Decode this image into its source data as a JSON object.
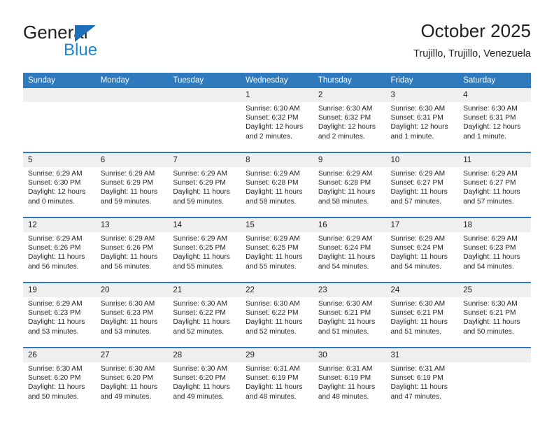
{
  "brand": {
    "name_part1": "General",
    "name_part2": "Blue",
    "triangle_color": "#1d6fb8",
    "blue_text_color": "#1b87d4"
  },
  "header": {
    "title": "October 2025",
    "subtitle": "Trujillo, Trujillo, Venezuela"
  },
  "theme": {
    "header_blue": "#2f79bd",
    "daynum_band": "#efefef",
    "text": "#231f20"
  },
  "weekdays": [
    "Sunday",
    "Monday",
    "Tuesday",
    "Wednesday",
    "Thursday",
    "Friday",
    "Saturday"
  ],
  "weeks": [
    {
      "days": [
        {
          "num": "",
          "sunrise": "",
          "sunset": "",
          "daylight": ""
        },
        {
          "num": "",
          "sunrise": "",
          "sunset": "",
          "daylight": ""
        },
        {
          "num": "",
          "sunrise": "",
          "sunset": "",
          "daylight": ""
        },
        {
          "num": "1",
          "sunrise": "Sunrise: 6:30 AM",
          "sunset": "Sunset: 6:32 PM",
          "daylight": "Daylight: 12 hours and 2 minutes."
        },
        {
          "num": "2",
          "sunrise": "Sunrise: 6:30 AM",
          "sunset": "Sunset: 6:32 PM",
          "daylight": "Daylight: 12 hours and 2 minutes."
        },
        {
          "num": "3",
          "sunrise": "Sunrise: 6:30 AM",
          "sunset": "Sunset: 6:31 PM",
          "daylight": "Daylight: 12 hours and 1 minute."
        },
        {
          "num": "4",
          "sunrise": "Sunrise: 6:30 AM",
          "sunset": "Sunset: 6:31 PM",
          "daylight": "Daylight: 12 hours and 1 minute."
        }
      ]
    },
    {
      "days": [
        {
          "num": "5",
          "sunrise": "Sunrise: 6:29 AM",
          "sunset": "Sunset: 6:30 PM",
          "daylight": "Daylight: 12 hours and 0 minutes."
        },
        {
          "num": "6",
          "sunrise": "Sunrise: 6:29 AM",
          "sunset": "Sunset: 6:29 PM",
          "daylight": "Daylight: 11 hours and 59 minutes."
        },
        {
          "num": "7",
          "sunrise": "Sunrise: 6:29 AM",
          "sunset": "Sunset: 6:29 PM",
          "daylight": "Daylight: 11 hours and 59 minutes."
        },
        {
          "num": "8",
          "sunrise": "Sunrise: 6:29 AM",
          "sunset": "Sunset: 6:28 PM",
          "daylight": "Daylight: 11 hours and 58 minutes."
        },
        {
          "num": "9",
          "sunrise": "Sunrise: 6:29 AM",
          "sunset": "Sunset: 6:28 PM",
          "daylight": "Daylight: 11 hours and 58 minutes."
        },
        {
          "num": "10",
          "sunrise": "Sunrise: 6:29 AM",
          "sunset": "Sunset: 6:27 PM",
          "daylight": "Daylight: 11 hours and 57 minutes."
        },
        {
          "num": "11",
          "sunrise": "Sunrise: 6:29 AM",
          "sunset": "Sunset: 6:27 PM",
          "daylight": "Daylight: 11 hours and 57 minutes."
        }
      ]
    },
    {
      "days": [
        {
          "num": "12",
          "sunrise": "Sunrise: 6:29 AM",
          "sunset": "Sunset: 6:26 PM",
          "daylight": "Daylight: 11 hours and 56 minutes."
        },
        {
          "num": "13",
          "sunrise": "Sunrise: 6:29 AM",
          "sunset": "Sunset: 6:26 PM",
          "daylight": "Daylight: 11 hours and 56 minutes."
        },
        {
          "num": "14",
          "sunrise": "Sunrise: 6:29 AM",
          "sunset": "Sunset: 6:25 PM",
          "daylight": "Daylight: 11 hours and 55 minutes."
        },
        {
          "num": "15",
          "sunrise": "Sunrise: 6:29 AM",
          "sunset": "Sunset: 6:25 PM",
          "daylight": "Daylight: 11 hours and 55 minutes."
        },
        {
          "num": "16",
          "sunrise": "Sunrise: 6:29 AM",
          "sunset": "Sunset: 6:24 PM",
          "daylight": "Daylight: 11 hours and 54 minutes."
        },
        {
          "num": "17",
          "sunrise": "Sunrise: 6:29 AM",
          "sunset": "Sunset: 6:24 PM",
          "daylight": "Daylight: 11 hours and 54 minutes."
        },
        {
          "num": "18",
          "sunrise": "Sunrise: 6:29 AM",
          "sunset": "Sunset: 6:23 PM",
          "daylight": "Daylight: 11 hours and 54 minutes."
        }
      ]
    },
    {
      "days": [
        {
          "num": "19",
          "sunrise": "Sunrise: 6:29 AM",
          "sunset": "Sunset: 6:23 PM",
          "daylight": "Daylight: 11 hours and 53 minutes."
        },
        {
          "num": "20",
          "sunrise": "Sunrise: 6:30 AM",
          "sunset": "Sunset: 6:23 PM",
          "daylight": "Daylight: 11 hours and 53 minutes."
        },
        {
          "num": "21",
          "sunrise": "Sunrise: 6:30 AM",
          "sunset": "Sunset: 6:22 PM",
          "daylight": "Daylight: 11 hours and 52 minutes."
        },
        {
          "num": "22",
          "sunrise": "Sunrise: 6:30 AM",
          "sunset": "Sunset: 6:22 PM",
          "daylight": "Daylight: 11 hours and 52 minutes."
        },
        {
          "num": "23",
          "sunrise": "Sunrise: 6:30 AM",
          "sunset": "Sunset: 6:21 PM",
          "daylight": "Daylight: 11 hours and 51 minutes."
        },
        {
          "num": "24",
          "sunrise": "Sunrise: 6:30 AM",
          "sunset": "Sunset: 6:21 PM",
          "daylight": "Daylight: 11 hours and 51 minutes."
        },
        {
          "num": "25",
          "sunrise": "Sunrise: 6:30 AM",
          "sunset": "Sunset: 6:21 PM",
          "daylight": "Daylight: 11 hours and 50 minutes."
        }
      ]
    },
    {
      "days": [
        {
          "num": "26",
          "sunrise": "Sunrise: 6:30 AM",
          "sunset": "Sunset: 6:20 PM",
          "daylight": "Daylight: 11 hours and 50 minutes."
        },
        {
          "num": "27",
          "sunrise": "Sunrise: 6:30 AM",
          "sunset": "Sunset: 6:20 PM",
          "daylight": "Daylight: 11 hours and 49 minutes."
        },
        {
          "num": "28",
          "sunrise": "Sunrise: 6:30 AM",
          "sunset": "Sunset: 6:20 PM",
          "daylight": "Daylight: 11 hours and 49 minutes."
        },
        {
          "num": "29",
          "sunrise": "Sunrise: 6:31 AM",
          "sunset": "Sunset: 6:19 PM",
          "daylight": "Daylight: 11 hours and 48 minutes."
        },
        {
          "num": "30",
          "sunrise": "Sunrise: 6:31 AM",
          "sunset": "Sunset: 6:19 PM",
          "daylight": "Daylight: 11 hours and 48 minutes."
        },
        {
          "num": "31",
          "sunrise": "Sunrise: 6:31 AM",
          "sunset": "Sunset: 6:19 PM",
          "daylight": "Daylight: 11 hours and 47 minutes."
        },
        {
          "num": "",
          "sunrise": "",
          "sunset": "",
          "daylight": ""
        }
      ]
    }
  ]
}
